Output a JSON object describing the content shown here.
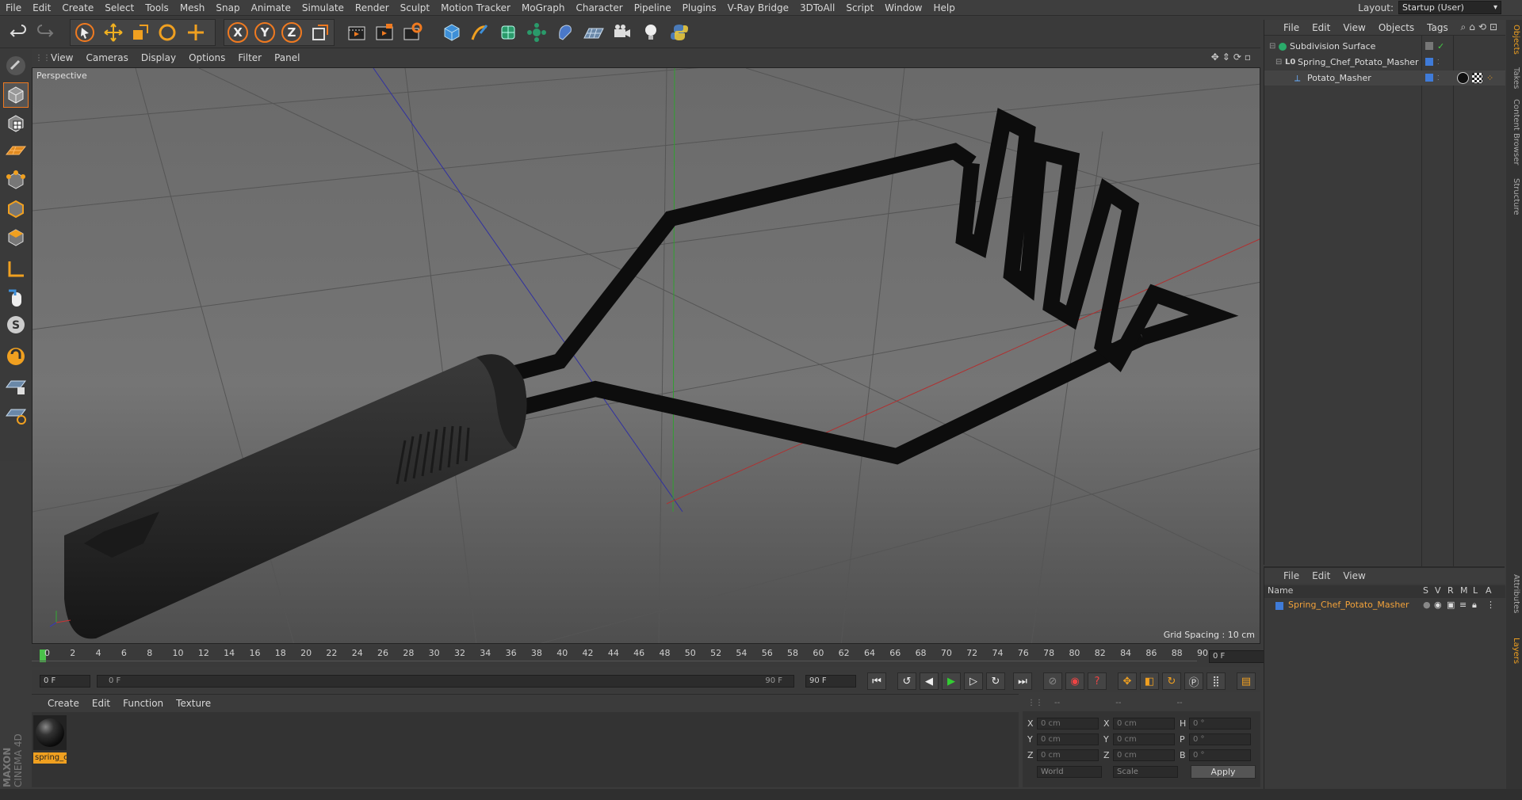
{
  "menubar": {
    "items": [
      "File",
      "Edit",
      "Create",
      "Select",
      "Tools",
      "Mesh",
      "Snap",
      "Animate",
      "Simulate",
      "Render",
      "Sculpt",
      "Motion Tracker",
      "MoGraph",
      "Character",
      "Pipeline",
      "Plugins",
      "V-Ray Bridge",
      "3DToAll",
      "Script",
      "Window",
      "Help"
    ],
    "layout_label": "Layout:",
    "layout_value": "Startup (User)"
  },
  "toolbar": {
    "icons": [
      "undo-icon",
      "redo-icon",
      "live-selection-icon",
      "move-icon",
      "scale-icon",
      "rotate-icon",
      "last-tool-icon",
      "x-axis-icon",
      "y-axis-icon",
      "z-axis-icon",
      "world-coordinates-icon",
      "render-view-icon",
      "render-picture-viewer-icon",
      "render-settings-icon",
      "cube-icon",
      "pen-icon",
      "subdivision-icon",
      "array-icon",
      "deformer-icon",
      "floor-icon",
      "camera-icon",
      "light-icon",
      "python-icon"
    ],
    "axis_labels": [
      "X",
      "Y",
      "Z"
    ]
  },
  "left_toolbar": {
    "icons": [
      "make-editable-icon",
      "model-mode-icon",
      "texture-mode-icon",
      "workplane-icon",
      "points-mode-icon",
      "edges-mode-icon",
      "polygons-mode-icon",
      "axis-mode-icon",
      "tweak-mode-icon",
      "solo-icon",
      "snap-magnet-icon",
      "lock-workplane-icon",
      "planar-workplane-icon"
    ]
  },
  "viewport": {
    "menu": [
      "View",
      "Cameras",
      "Display",
      "Options",
      "Filter",
      "Panel"
    ],
    "label": "Perspective",
    "grid_spacing": "Grid Spacing : 10 cm"
  },
  "timeline": {
    "ticks": [
      "0",
      "2",
      "4",
      "6",
      "8",
      "10",
      "12",
      "14",
      "16",
      "18",
      "20",
      "22",
      "24",
      "26",
      "28",
      "30",
      "32",
      "34",
      "36",
      "38",
      "40",
      "42",
      "44",
      "46",
      "48",
      "50",
      "52",
      "54",
      "56",
      "58",
      "60",
      "62",
      "64",
      "66",
      "68",
      "70",
      "72",
      "74",
      "76",
      "78",
      "80",
      "82",
      "84",
      "86",
      "88",
      "90"
    ],
    "current_frame": "0 F"
  },
  "transport": {
    "start_field": "0 F",
    "range_start": "0 F",
    "range_end": "90 F",
    "end_field": "90 F"
  },
  "material_panel": {
    "menu": [
      "Create",
      "Edit",
      "Function",
      "Texture"
    ],
    "material_name": "spring_c"
  },
  "attributes": {
    "header": "--",
    "header2": "--",
    "header3": "--",
    "rows": [
      {
        "a": "X",
        "av": "0 cm",
        "b": "X",
        "bv": "0 cm",
        "c": "H",
        "cv": "0 °"
      },
      {
        "a": "Y",
        "av": "0 cm",
        "b": "Y",
        "bv": "0 cm",
        "c": "P",
        "cv": "0 °"
      },
      {
        "a": "Z",
        "av": "0 cm",
        "b": "Z",
        "bv": "0 cm",
        "c": "B",
        "cv": "0 °"
      }
    ],
    "coord_mode": "World",
    "size_mode": "Scale",
    "apply": "Apply"
  },
  "object_manager": {
    "menu": [
      "File",
      "Edit",
      "View",
      "Objects",
      "Tags"
    ],
    "objects": [
      {
        "name": "Subdivision Surface",
        "indent": 0
      },
      {
        "name": "Spring_Chef_Potato_Masher",
        "indent": 1
      },
      {
        "name": "Potato_Masher",
        "indent": 2
      }
    ]
  },
  "layer_manager": {
    "menu": [
      "File",
      "Edit",
      "View"
    ],
    "columns": [
      "Name",
      "S",
      "V",
      "R",
      "M",
      "L",
      "A"
    ],
    "layers": [
      {
        "name": "Spring_Chef_Potato_Masher",
        "color": "#3f7bd8"
      }
    ]
  },
  "side_tabs": [
    "Objects",
    "Takes",
    "Content Browser",
    "Structure",
    "Attributes",
    "Layers"
  ],
  "brand": [
    "MAXON",
    "CINEMA 4D"
  ],
  "colors": {
    "accent": "#f0a020",
    "layer_blue": "#3f7bd8",
    "selected_text": "#f2a23a"
  }
}
